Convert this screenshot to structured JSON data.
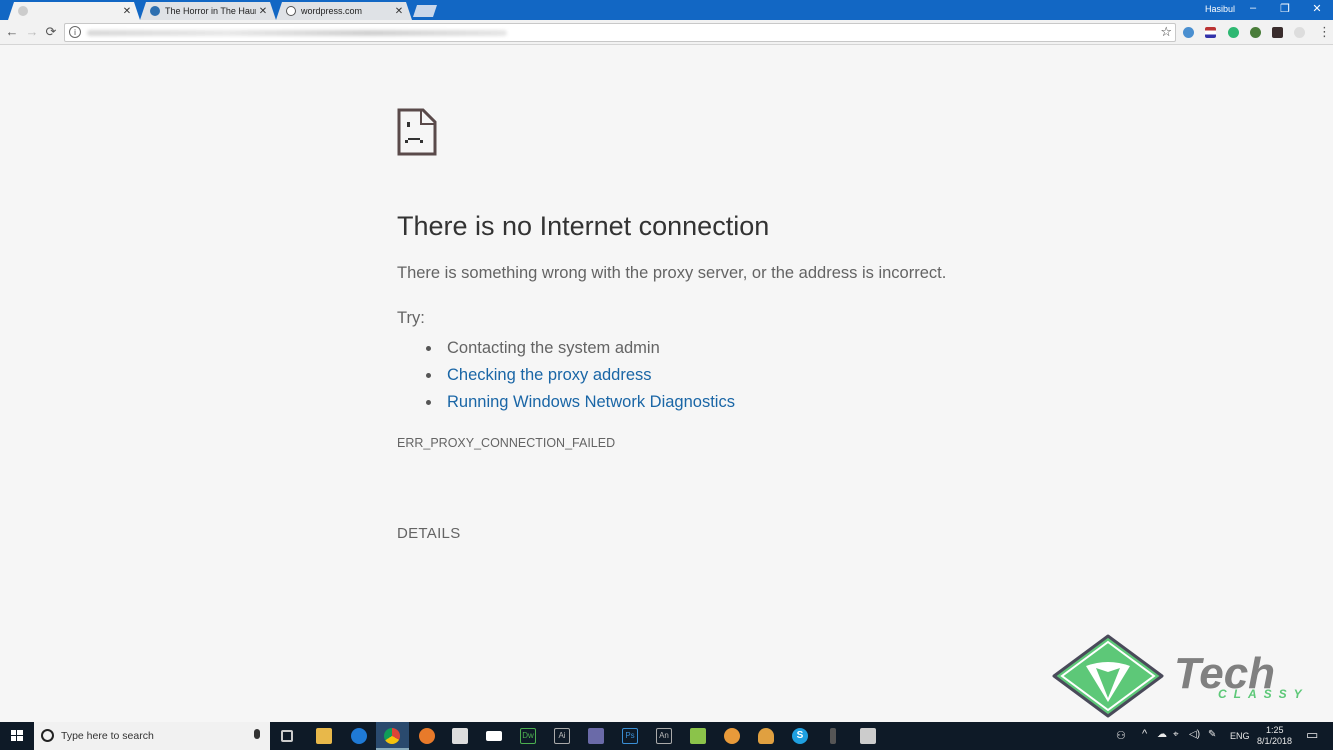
{
  "browser": {
    "tabs": [
      {
        "title": "",
        "favicon": "blurred-favicon",
        "active": true
      },
      {
        "title": "The Horror in The Haunt",
        "favicon": "globe-favicon",
        "active": false
      },
      {
        "title": "wordpress.com",
        "favicon": "wordpress-favicon",
        "active": false
      }
    ],
    "user_name": "Hasibul",
    "window_controls": {
      "minimize": "–",
      "restore": "❐",
      "close": "✕"
    },
    "tab_close": "✕",
    "nav": {
      "back": "←",
      "forward": "→",
      "reload": "⟳"
    },
    "address_info_icon": "i",
    "bookmark_star": "☆",
    "menu": "⋮",
    "extensions": [
      "profile-extension",
      "flag-extension",
      "grammarly-extension",
      "globe-extension",
      "mega-extension",
      "gray-extension"
    ]
  },
  "page": {
    "title": "There is no Internet connection",
    "description": "There is something wrong with the proxy server, or the address is incorrect.",
    "try_label": "Try:",
    "suggestions": [
      {
        "text": "Contacting the system admin",
        "link": false
      },
      {
        "text": "Checking the proxy address",
        "link": true
      },
      {
        "text": "Running Windows Network Diagnostics",
        "link": true
      }
    ],
    "error_code": "ERR_PROXY_CONNECTION_FAILED",
    "details_button": "DETAILS",
    "link_color": "#1a66a6"
  },
  "watermark": {
    "brand_top": "Tech",
    "brand_bottom": "CLASSY",
    "accent": "#5dc878"
  },
  "taskbar": {
    "search_placeholder": "Type here to search",
    "apps": [
      "task-view",
      "file-explorer",
      "edge",
      "chrome",
      "firefox",
      "store",
      "mail",
      "dreamweaver",
      "illustrator",
      "visual-studio",
      "photoshop",
      "animate",
      "paint",
      "blender",
      "vlc",
      "skype",
      "notepad",
      "network-app"
    ],
    "app_labels": {
      "dreamweaver": "Dw",
      "illustrator": "Ai",
      "photoshop": "Ps",
      "animate": "An",
      "skype": "S"
    },
    "language": "ENG",
    "time": "1:25",
    "date": "8/1/2018"
  }
}
